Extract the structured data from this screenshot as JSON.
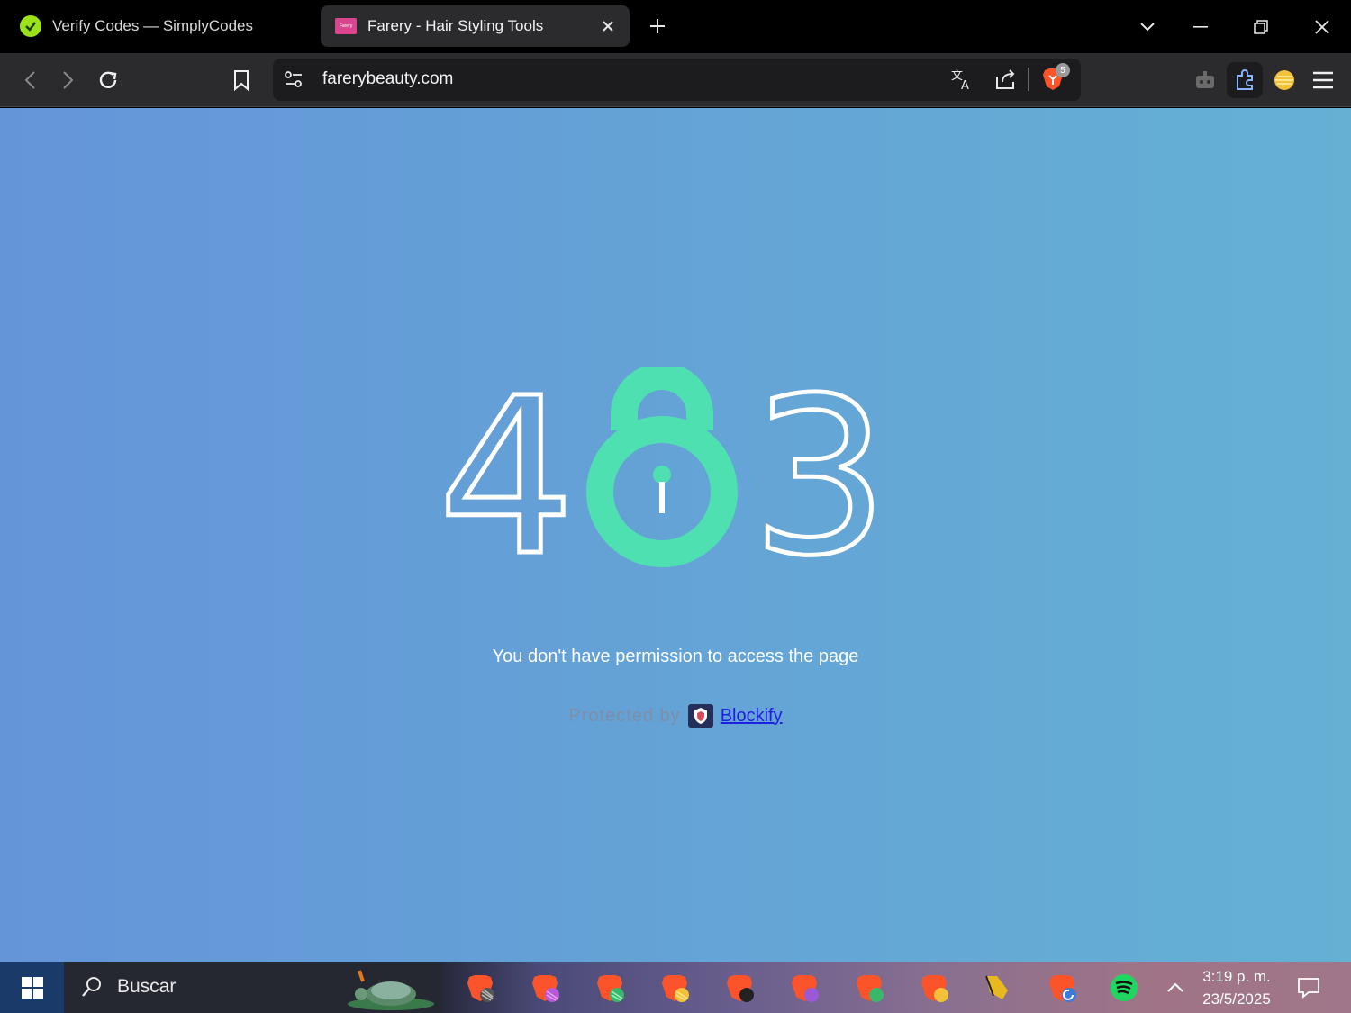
{
  "browser": {
    "tabs": [
      {
        "label": "Verify Codes — SimplyCodes",
        "active": false
      },
      {
        "label": "Farery - Hair Styling Tools",
        "active": true,
        "favicon_text": "Farery"
      }
    ],
    "url": "farerybeauty.com",
    "shields_count": "5"
  },
  "page": {
    "error_code": "403",
    "message": "You don't have permission to access the page",
    "protected_by": "Protected by",
    "protector_link": "Blockify",
    "colors": {
      "lock": "#4fe0b2",
      "digits_outline": "#ffffff",
      "link": "#1f1fe0"
    }
  },
  "taskbar": {
    "search_label": "Buscar",
    "time": "3:19 p. m.",
    "date": "23/5/2025",
    "pinned": [
      "brave-icon",
      "brave-icon",
      "brave-icon",
      "brave-icon",
      "brave-icon",
      "brave-icon",
      "brave-icon",
      "brave-icon",
      "cursor-app-icon",
      "brave-icon",
      "spotify-icon"
    ]
  }
}
